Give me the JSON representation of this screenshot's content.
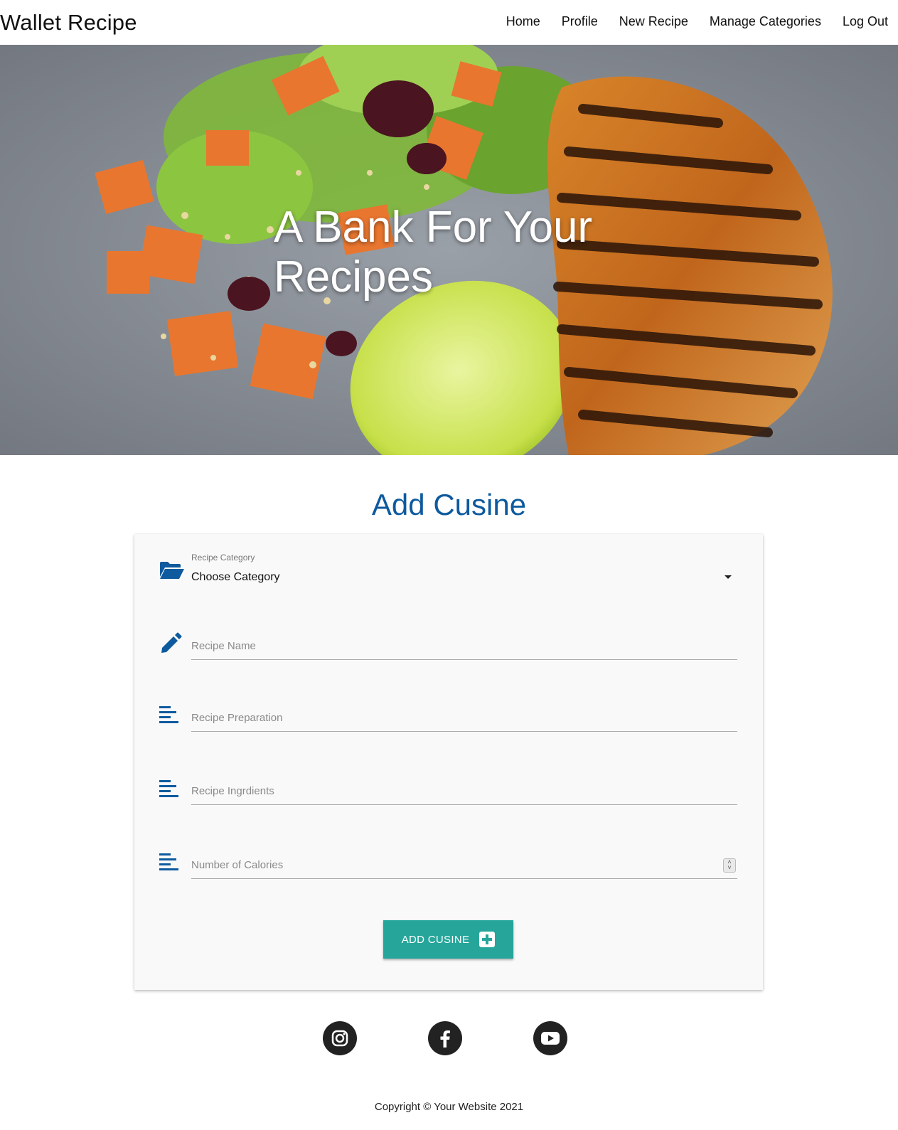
{
  "brand": "Wallet Recipe",
  "nav": {
    "items": [
      {
        "label": "Home"
      },
      {
        "label": "Profile"
      },
      {
        "label": "New Recipe"
      },
      {
        "label": "Manage Categories"
      },
      {
        "label": "Log Out"
      }
    ]
  },
  "hero": {
    "title": "A Bank For Your Recipes",
    "image_icon": "food-hero-image"
  },
  "form": {
    "title": "Add Cusine",
    "category": {
      "label": "Recipe Category",
      "selected": "Choose Category",
      "icon": "folder-open-icon"
    },
    "recipe_name": {
      "placeholder": "Recipe Name",
      "value": "",
      "icon": "pencil-icon"
    },
    "preparation": {
      "placeholder": "Recipe Preparation",
      "value": "",
      "icon": "align-left-icon"
    },
    "ingredients": {
      "placeholder": "Recipe Ingrdients",
      "value": "",
      "icon": "align-left-icon"
    },
    "calories": {
      "placeholder": "Number of Calories",
      "value": "",
      "icon": "align-left-icon"
    },
    "submit_label": "ADD CUSINE",
    "submit_icon": "plus-square-icon"
  },
  "social": [
    {
      "name": "instagram-icon"
    },
    {
      "name": "facebook-icon"
    },
    {
      "name": "youtube-icon"
    }
  ],
  "footer": {
    "copyright": "Copyright © Your Website 2021"
  },
  "colors": {
    "accent": "#26a69a",
    "primary": "#0d5a9e",
    "icon_blue": "#0d5a9e"
  }
}
